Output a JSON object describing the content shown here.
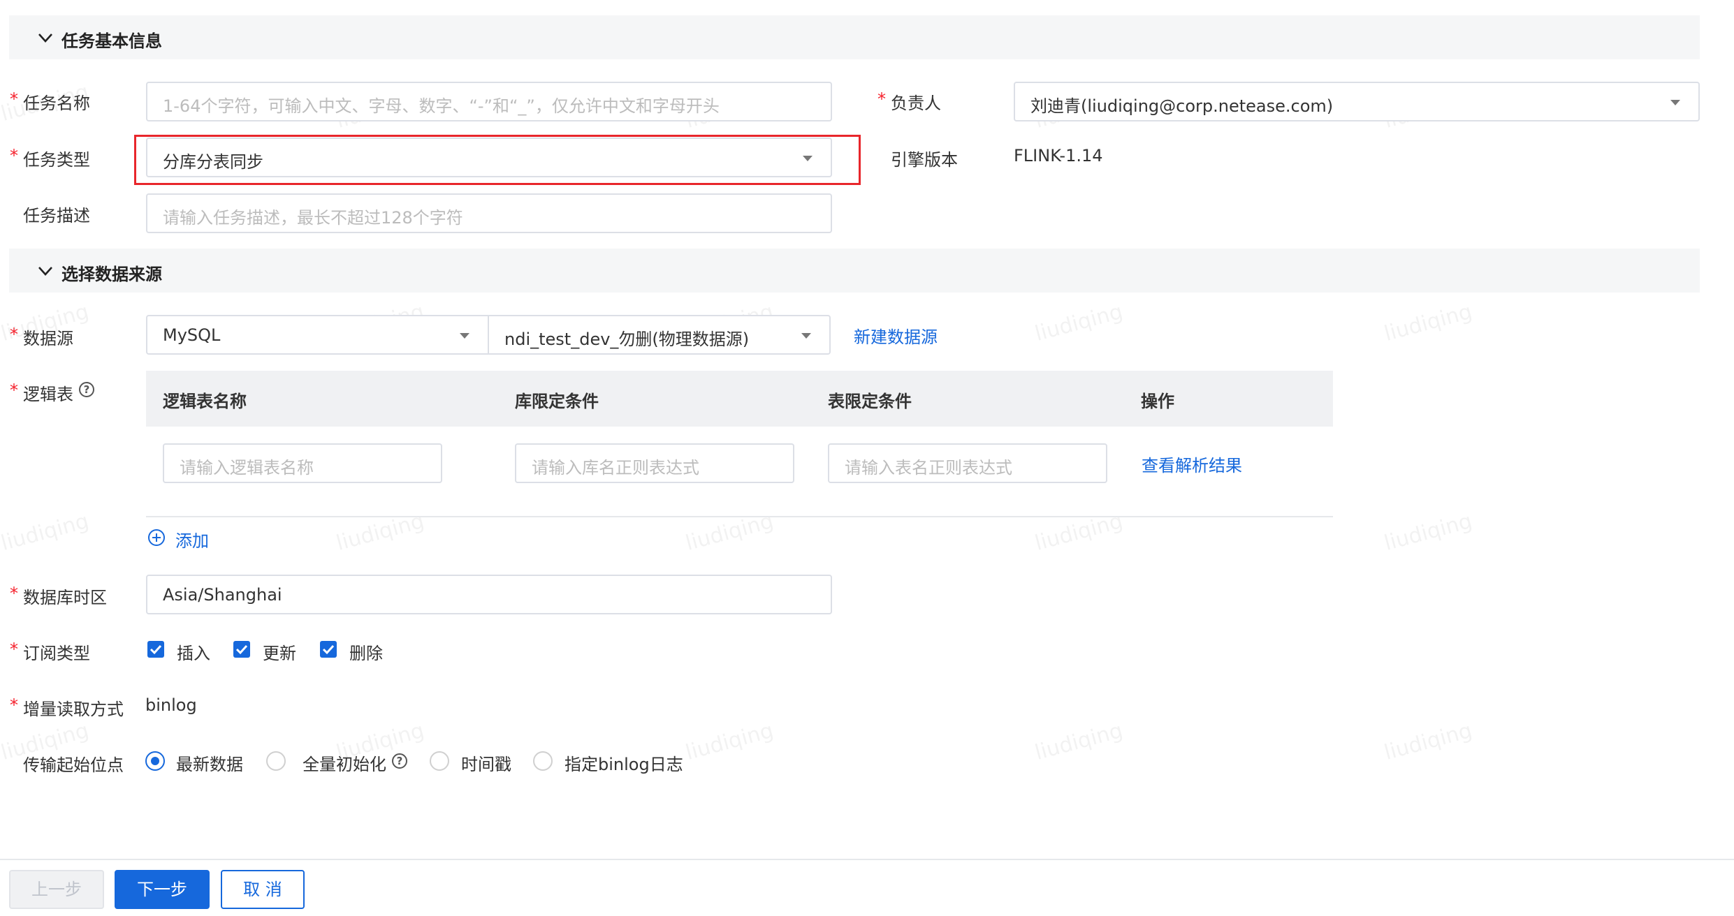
{
  "sections": {
    "basic_info": "任务基本信息",
    "data_source": "选择数据来源"
  },
  "form": {
    "task_name": {
      "label": "任务名称",
      "placeholder": "1-64个字符，可输入中文、字母、数字、“-”和“_”，仅允许中文和字母开头"
    },
    "owner": {
      "label": "负责人",
      "value": "刘迪青(liudiqing@corp.netease.com)"
    },
    "task_type": {
      "label": "任务类型",
      "value": "分库分表同步"
    },
    "engine_version": {
      "label": "引擎版本",
      "value": "FLINK-1.14"
    },
    "task_desc": {
      "label": "任务描述",
      "placeholder": "请输入任务描述，最长不超过128个字符"
    },
    "datasource": {
      "label": "数据源",
      "type_value": "MySQL",
      "source_value": "ndi_test_dev_勿删(物理数据源)",
      "new_link": "新建数据源"
    },
    "logic_table": {
      "label": "逻辑表",
      "help": "?",
      "columns": [
        "逻辑表名称",
        "库限定条件",
        "表限定条件",
        "操作"
      ],
      "row": {
        "name_placeholder": "请输入逻辑表名称",
        "db_placeholder": "请输入库名正则表达式",
        "table_placeholder": "请输入表名正则表达式",
        "action": "查看解析结果"
      },
      "add": "添加"
    },
    "timezone": {
      "label": "数据库时区",
      "value": "Asia/Shanghai"
    },
    "subscribe": {
      "label": "订阅类型",
      "options": [
        "插入",
        "更新",
        "删除"
      ]
    },
    "incremental": {
      "label": "增量读取方式",
      "value": "binlog"
    },
    "start_position": {
      "label": "传输起始位点",
      "options": [
        "最新数据",
        "全量初始化",
        "时间戳",
        "指定binlog日志"
      ],
      "help": "?"
    }
  },
  "footer": {
    "prev": "上一步",
    "next": "下一步",
    "cancel": "取 消"
  },
  "watermark": "liudiqing",
  "colors": {
    "accent": "#1668dc",
    "required": "#f5222d",
    "highlight": "#e8262b"
  }
}
